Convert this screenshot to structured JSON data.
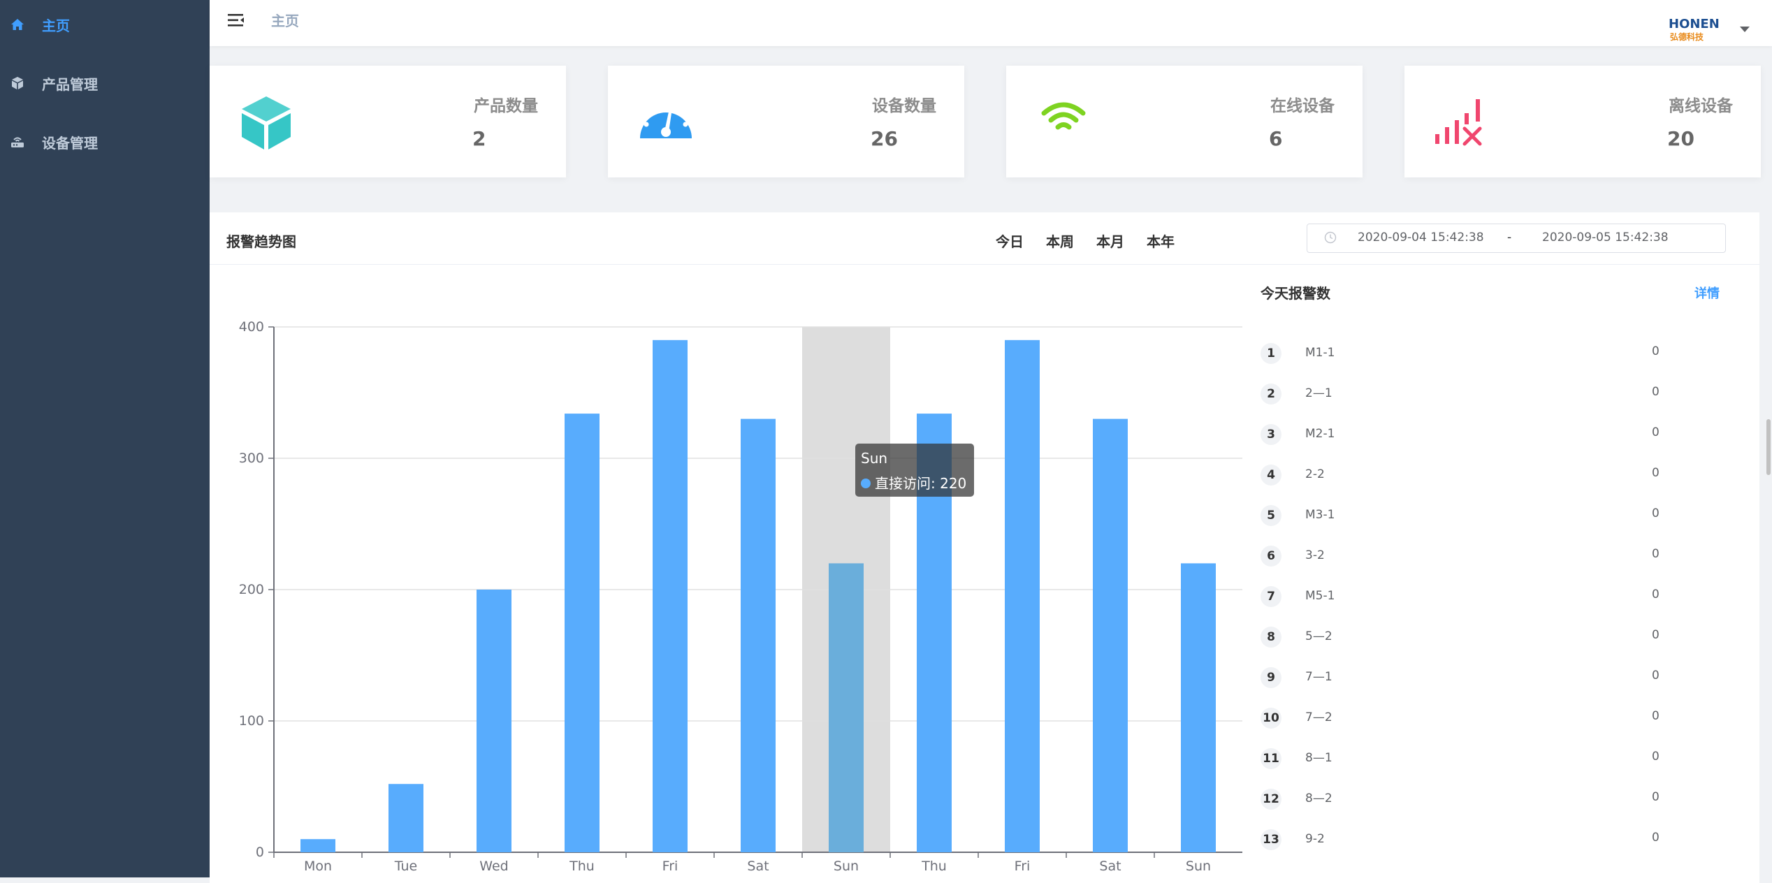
{
  "sidebar": {
    "items": [
      {
        "label": "主页",
        "icon": "home-icon",
        "active": true
      },
      {
        "label": "产品管理",
        "icon": "cube-icon",
        "active": false
      },
      {
        "label": "设备管理",
        "icon": "router-icon",
        "active": false
      }
    ]
  },
  "header": {
    "breadcrumb": "主页",
    "logo_text": "HONEN",
    "logo_subtext": "弘德科技"
  },
  "stats": [
    {
      "label": "产品数量",
      "value": "2",
      "icon": "cube-icon",
      "color": "#36c6c6"
    },
    {
      "label": "设备数量",
      "value": "26",
      "icon": "speedometer-icon",
      "color": "#2f9bf1"
    },
    {
      "label": "在线设备",
      "value": "6",
      "icon": "wifi-icon",
      "color": "#7ed321"
    },
    {
      "label": "离线设备",
      "value": "20",
      "icon": "signal-off-icon",
      "color": "#f0466e"
    }
  ],
  "trend": {
    "title": "报警趋势图",
    "ranges": [
      "今日",
      "本周",
      "本月",
      "本年"
    ],
    "date_start": "2020-09-04 15:42:38",
    "date_separator": "-",
    "date_end": "2020-09-05 15:42:38"
  },
  "chart_data": {
    "type": "bar",
    "categories": [
      "Mon",
      "Tue",
      "Wed",
      "Thu",
      "Fri",
      "Sat",
      "Sun",
      "Thu",
      "Fri",
      "Sat",
      "Sun"
    ],
    "series": [
      {
        "name": "直接访问",
        "values": [
          10,
          52,
          200,
          334,
          390,
          330,
          220,
          334,
          390,
          330,
          220
        ]
      }
    ],
    "ylim": [
      0,
      400
    ],
    "yticks": [
      0,
      100,
      200,
      300,
      400
    ],
    "bar_color": "#58acfd",
    "highlight_color": "#6aaedb",
    "grid": true,
    "tooltip": {
      "category": "Sun",
      "index": 6,
      "series": "直接访问",
      "value": 220
    }
  },
  "alarms": {
    "title": "今天报警数",
    "detail_label": "详情",
    "items": [
      {
        "rank": "1",
        "name": "M1-1",
        "count": "0"
      },
      {
        "rank": "2",
        "name": "2—1",
        "count": "0"
      },
      {
        "rank": "3",
        "name": "M2-1",
        "count": "0"
      },
      {
        "rank": "4",
        "name": "2-2",
        "count": "0"
      },
      {
        "rank": "5",
        "name": "M3-1",
        "count": "0"
      },
      {
        "rank": "6",
        "name": "3-2",
        "count": "0"
      },
      {
        "rank": "7",
        "name": "M5-1",
        "count": "0"
      },
      {
        "rank": "8",
        "name": "5—2",
        "count": "0"
      },
      {
        "rank": "9",
        "name": "7—1",
        "count": "0"
      },
      {
        "rank": "10",
        "name": "7—2",
        "count": "0"
      },
      {
        "rank": "11",
        "name": "8—1",
        "count": "0"
      },
      {
        "rank": "12",
        "name": "8—2",
        "count": "0"
      },
      {
        "rank": "13",
        "name": "9-2",
        "count": "0"
      }
    ]
  }
}
